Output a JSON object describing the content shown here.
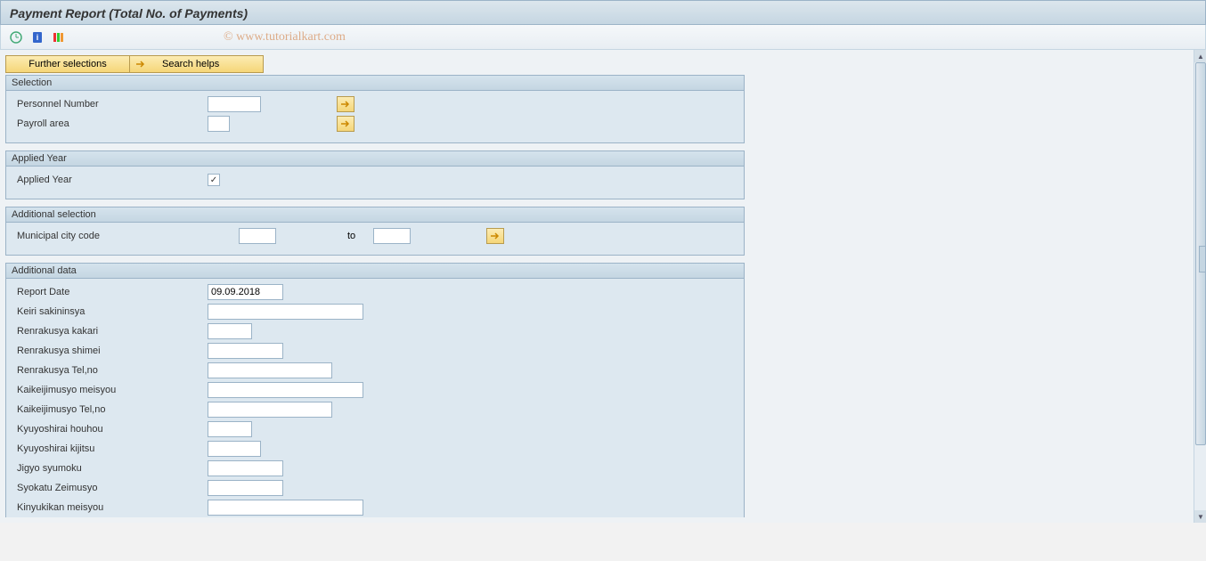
{
  "header": {
    "title": "Payment Report (Total No. of Payments)"
  },
  "watermark": "© www.tutorialkart.com",
  "app_toolbar": {
    "further_selections": "Further selections",
    "search_helps": "Search helps"
  },
  "groups": {
    "selection": {
      "title": "Selection",
      "personnel_number_label": "Personnel Number",
      "personnel_number_value": "",
      "payroll_area_label": "Payroll area",
      "payroll_area_value": ""
    },
    "applied_year": {
      "title": "Applied Year",
      "applied_year_label": "Applied Year",
      "applied_year_checked": true
    },
    "additional_selection": {
      "title": "Additional selection",
      "municipal_city_code_label": "Municipal city code",
      "municipal_city_code_from": "",
      "to_label": "to",
      "municipal_city_code_to": ""
    },
    "additional_data": {
      "title": "Additional data",
      "fields": [
        {
          "label": "Report Date",
          "value": "09.09.2018",
          "width": "w-md"
        },
        {
          "label": "Keiri sakininsya",
          "value": "",
          "width": "w-xl"
        },
        {
          "label": "Renrakusya kakari",
          "value": "",
          "width": "w-xs"
        },
        {
          "label": "Renrakusya shimei",
          "value": "",
          "width": "w-md"
        },
        {
          "label": "Renrakusya Tel,no",
          "value": "",
          "width": "w-lg"
        },
        {
          "label": "Kaikeijimusyo meisyou",
          "value": "",
          "width": "w-xl"
        },
        {
          "label": "Kaikeijimusyo Tel,no",
          "value": "",
          "width": "w-lg"
        },
        {
          "label": "Kyuyoshirai houhou",
          "value": "",
          "width": "w-xs"
        },
        {
          "label": "Kyuyoshirai kijitsu",
          "value": "",
          "width": "w-sm"
        },
        {
          "label": "Jigyo syumoku",
          "value": "",
          "width": "w-md"
        },
        {
          "label": "Syokatu Zeimusyo",
          "value": "",
          "width": "w-md"
        },
        {
          "label": "Kinyukikan meisyou",
          "value": "",
          "width": "w-xl"
        }
      ]
    }
  }
}
